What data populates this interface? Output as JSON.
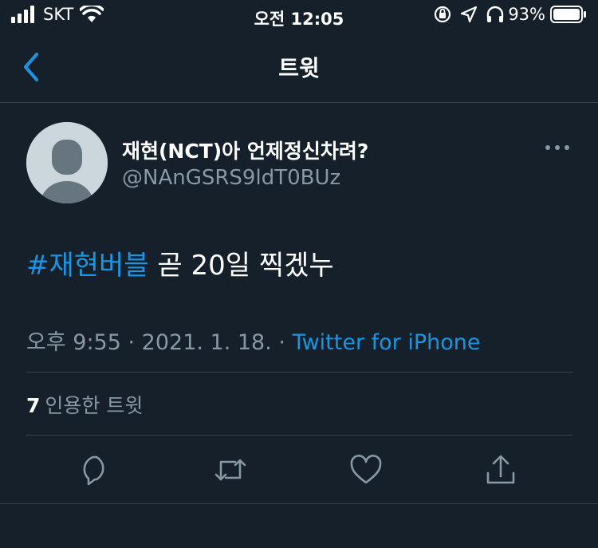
{
  "status_bar": {
    "carrier": "SKT",
    "time": "오전 12:05",
    "battery": "93%"
  },
  "nav": {
    "title": "트윗",
    "back_icon": "chevron-left-icon"
  },
  "tweet": {
    "display_name": "재현(NCT)아 언제정신차려?",
    "handle": "@NAnGSRS9ldT0BUz",
    "hashtag": "#재현버블",
    "text": " 곧 20일 찍겠누",
    "time": "오후 9:55",
    "sep1": " · ",
    "date": "2021. 1. 18.",
    "sep2": " · ",
    "source": "Twitter for iPhone",
    "quote_count": "7",
    "quote_label": "인용한 트윗"
  },
  "actions": [
    "reply-icon",
    "retweet-icon",
    "like-icon",
    "share-icon"
  ],
  "colors": {
    "background": "#15202b",
    "accent": "#1b95e0",
    "secondary_text": "#8899a6",
    "divider": "#38444d"
  }
}
